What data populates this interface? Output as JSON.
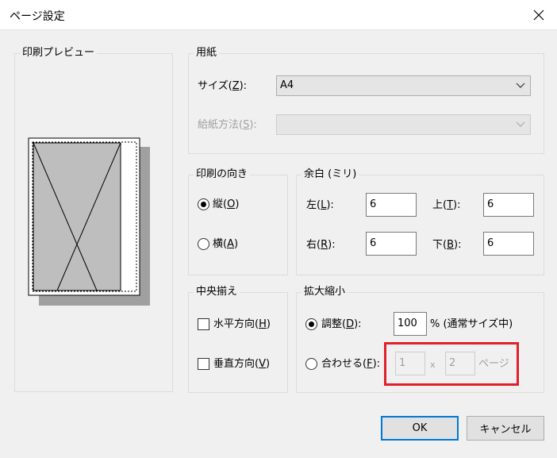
{
  "window": {
    "title": "ページ設定"
  },
  "preview": {
    "legend": "印刷プレビュー"
  },
  "paper": {
    "legend": "用紙",
    "size_label": "サイズ(",
    "size_key": "Z",
    "size_tail": "):",
    "size_value": "A4",
    "source_label": "給紙方法(",
    "source_key": "S",
    "source_tail": "):",
    "source_value": ""
  },
  "orientation": {
    "legend": "印刷の向き",
    "portrait_label": "縦(",
    "portrait_key": "O",
    "portrait_tail": ")",
    "landscape_label": "横(",
    "landscape_key": "A",
    "landscape_tail": ")"
  },
  "margins": {
    "legend": "余白 (ミリ)",
    "left_label": "左(",
    "left_key": "L",
    "left_tail": "):",
    "left_value": "6",
    "top_label": "上(",
    "top_key": "T",
    "top_tail": "):",
    "top_value": "6",
    "right_label": "右(",
    "right_key": "R",
    "right_tail": "):",
    "right_value": "6",
    "bottom_label": "下(",
    "bottom_key": "B",
    "bottom_tail": "):",
    "bottom_value": "6"
  },
  "center": {
    "legend": "中央揃え",
    "horizontal_label": "水平方向(",
    "horizontal_key": "H",
    "horizontal_tail": ")",
    "vertical_label": "垂直方向(",
    "vertical_key": "V",
    "vertical_tail": ")"
  },
  "scale": {
    "legend": "拡大縮小",
    "adjust_label": "調整(",
    "adjust_key": "D",
    "adjust_tail": "):",
    "adjust_value": "100",
    "adjust_suffix": "% (通常サイズ中)",
    "fit_label": "合わせる(",
    "fit_key": "F",
    "fit_tail": "):",
    "fit_wide": "1",
    "fit_x": "x",
    "fit_tall": "2",
    "fit_suffix": "ページ"
  },
  "buttons": {
    "ok": "OK",
    "cancel": "キャンセル"
  },
  "colors": {
    "highlight": "#e0202a",
    "default_button": "#0078d7"
  }
}
